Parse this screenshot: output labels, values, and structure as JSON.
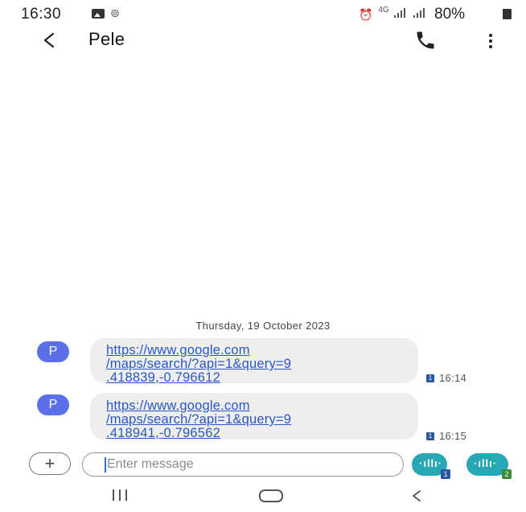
{
  "status_bar": {
    "time": "16:30",
    "battery": "80%",
    "data_indicator": "4G"
  },
  "header": {
    "contact_name": "Pele",
    "back_icon": "back-arrow-icon",
    "call_icon": "phone-icon",
    "more_icon": "more-vertical-icon"
  },
  "conversation": {
    "date_divider": "Thursday, 19 October 2023",
    "messages": [
      {
        "avatar_letter": "P",
        "lines": [
          "https://www.google.com",
          "/maps/search/?api=1&query=9",
          ".418839,-0.796612"
        ],
        "sim": "1",
        "time": "16:14"
      },
      {
        "avatar_letter": "P",
        "lines": [
          "https://www.google.com",
          "/maps/search/?api=1&query=9",
          ".418941,-0.796562"
        ],
        "sim": "1",
        "time": "16:15"
      }
    ]
  },
  "composer": {
    "placeholder": "Enter message",
    "attach_symbol": "+",
    "send_sim1_label": "1",
    "send_sim2_label": "2",
    "send_sim1_color": "#2a56a0",
    "send_sim2_color": "#3a8a3a"
  },
  "colors": {
    "accent": "#28a7b4",
    "avatar": "#5a6fe8",
    "link": "#2a56c6"
  }
}
